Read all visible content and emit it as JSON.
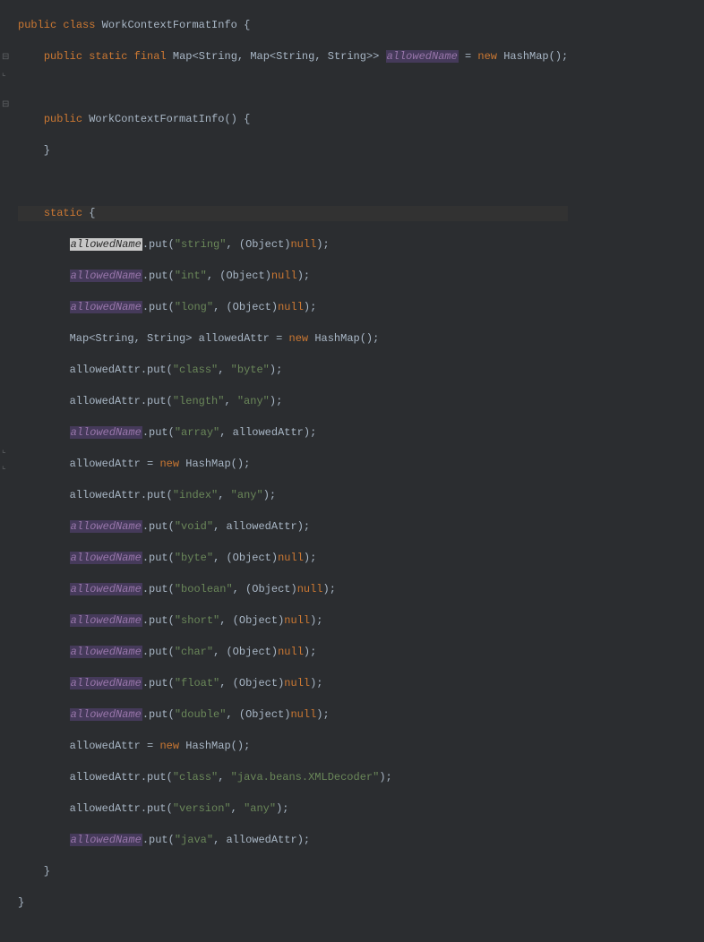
{
  "kw": {
    "public": "public",
    "class": "class",
    "static": "static",
    "final": "final",
    "new": "new",
    "null": "null"
  },
  "cls": {
    "WorkContextFormatInfo": "WorkContextFormatInfo",
    "Map": "Map",
    "String": "String",
    "HashMap": "HashMap",
    "Object": "Object"
  },
  "field": {
    "allowedName": "allowedName"
  },
  "local": {
    "allowedAttr": "allowedAttr"
  },
  "method": {
    "put": "put"
  },
  "str": {
    "string": "\"string\"",
    "int": "\"int\"",
    "long": "\"long\"",
    "class": "\"class\"",
    "byte": "\"byte\"",
    "length": "\"length\"",
    "any": "\"any\"",
    "array": "\"array\"",
    "index": "\"index\"",
    "void": "\"void\"",
    "boolean": "\"boolean\"",
    "short": "\"short\"",
    "char": "\"char\"",
    "float": "\"float\"",
    "double": "\"double\"",
    "xmldec": "\"java.beans.XMLDecoder\"",
    "version": "\"version\"",
    "java": "\"java\""
  },
  "fold": {
    "minus": "⊟",
    "end": "⌞"
  }
}
